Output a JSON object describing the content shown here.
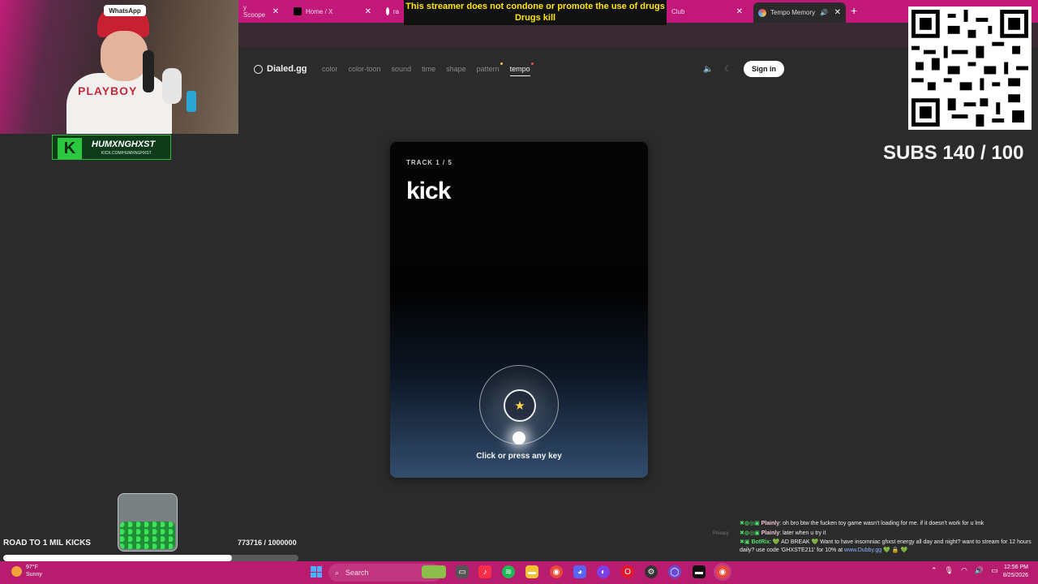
{
  "browser": {
    "tabs": [
      {
        "label": "y Scoope",
        "active": false
      },
      {
        "label": "Home / X",
        "active": false
      },
      {
        "label": "ra",
        "active": false
      },
      {
        "label": "Club",
        "active": false
      },
      {
        "label": "Tempo Memory",
        "active": true
      }
    ],
    "new_tab_symbol": "+"
  },
  "site": {
    "brand": "Dialed.gg",
    "nav": [
      "color",
      "color-toon",
      "sound",
      "time",
      "shape",
      "pattern",
      "tempo"
    ],
    "active_nav": "tempo",
    "sign_in": "Sign in",
    "colors": {
      "pattern_dot": "#f5c542",
      "tempo_dot": "#e8505b"
    }
  },
  "card": {
    "track_label": "TRACK 1 / 5",
    "title": "kick",
    "cta": "Click or press any key"
  },
  "overlay": {
    "warning_line1": "This streamer does not condone or promote the use of drugs",
    "warning_line2": "Drugs kill",
    "streamer_name": "HUMXNGHXST",
    "streamer_url": "KICK.COM/HUMXNGHXST",
    "webcam_badge": "WhatsApp",
    "shirt_text": "PLAYBOY",
    "subs": "SUBS 140 / 100",
    "goal_label": "ROAD TO 1 MIL KICKS",
    "goal_count": "773716 / 1000000",
    "goal_progress": 0.7737
  },
  "chat": {
    "privacy": "Privacy",
    "messages": [
      {
        "user": "Plainly",
        "text": ": oh bro btw the fucken toy game wasn't loading for me. if it doesn't work for u lmk"
      },
      {
        "user": "Plainly",
        "text": ": later when u try it"
      },
      {
        "user": "BotRix",
        "text": ": 💚 AD BREAK 💚 Want to have insomniac ghxst energy all day and night? want to stream for 12 hours daily? use code 'GHXSTE211' for 10% at ",
        "link": "www.Dubby.gg",
        "suffix": " 💚 🔒 💚"
      }
    ]
  },
  "taskbar": {
    "weather_temp": "97°F",
    "weather_desc": "Sunny",
    "search": "Search",
    "time": "12:56 PM",
    "date": "8/25/2026"
  }
}
